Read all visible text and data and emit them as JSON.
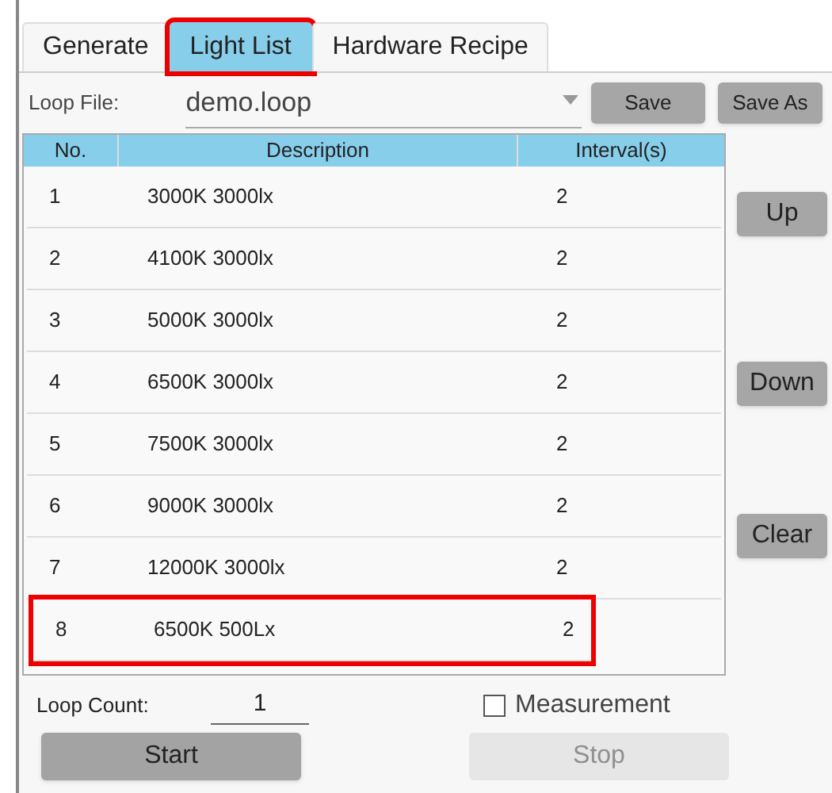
{
  "tabs": [
    {
      "label": "Generate",
      "selected": false,
      "highlighted": false
    },
    {
      "label": "Light List",
      "selected": true,
      "highlighted": true
    },
    {
      "label": "Hardware Recipe",
      "selected": false,
      "highlighted": false
    }
  ],
  "loop_file": {
    "label": "Loop File:",
    "value": "demo.loop"
  },
  "file_buttons": [
    "Save",
    "Save As"
  ],
  "table": {
    "columns": [
      "No.",
      "Description",
      "Interval(s)"
    ],
    "rows": [
      {
        "cells": [
          "1",
          "3000K 3000lx",
          "2"
        ],
        "highlighted": false
      },
      {
        "cells": [
          "2",
          "4100K 3000lx",
          "2"
        ],
        "highlighted": false
      },
      {
        "cells": [
          "3",
          "5000K 3000lx",
          "2"
        ],
        "highlighted": false
      },
      {
        "cells": [
          "4",
          "6500K 3000lx",
          "2"
        ],
        "highlighted": false
      },
      {
        "cells": [
          "5",
          "7500K 3000lx",
          "2"
        ],
        "highlighted": false
      },
      {
        "cells": [
          "6",
          "9000K 3000lx",
          "2"
        ],
        "highlighted": false
      },
      {
        "cells": [
          "7",
          "12000K 3000lx",
          "2"
        ],
        "highlighted": false
      },
      {
        "cells": [
          "8",
          "6500K 500Lx",
          "2"
        ],
        "highlighted": true
      }
    ]
  },
  "side_buttons": [
    "Up",
    "Down",
    "Clear"
  ],
  "loop_count": {
    "label": "Loop Count:",
    "value": "1"
  },
  "measurement": {
    "label": "Measurement",
    "checked": false
  },
  "actions": [
    {
      "label": "Start",
      "disabled": false
    },
    {
      "label": "Stop",
      "disabled": true
    }
  ]
}
